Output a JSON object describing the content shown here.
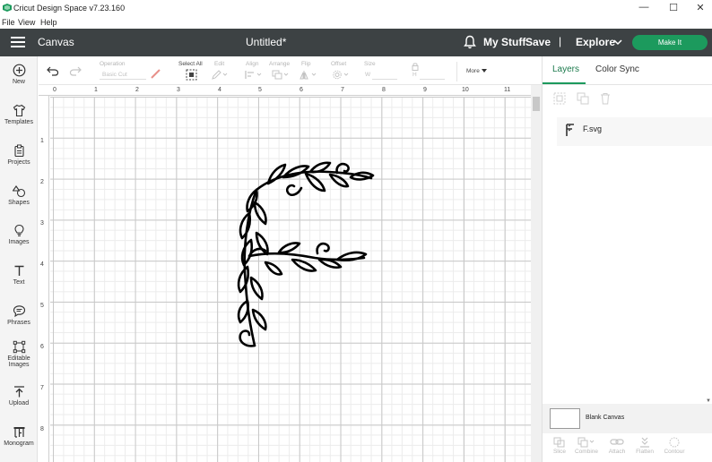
{
  "window": {
    "title": "Cricut Design Space  v7.23.160",
    "controls": [
      "—",
      "☐",
      "✕"
    ]
  },
  "menu": [
    "File",
    "View",
    "Help"
  ],
  "header": {
    "section": "Canvas",
    "document_title": "Untitled*",
    "my_stuff": "My Stuff",
    "save": "Save",
    "separator": "|",
    "explore": "Explore",
    "make_it": "Make It"
  },
  "sidebar": {
    "items": [
      {
        "label": "New",
        "icon": "plus-circle-icon"
      },
      {
        "label": "Templates",
        "icon": "tshirt-icon"
      },
      {
        "label": "Projects",
        "icon": "clipboard-icon"
      },
      {
        "label": "Shapes",
        "icon": "shapes-icon"
      },
      {
        "label": "Images",
        "icon": "lightbulb-icon"
      },
      {
        "label": "Text",
        "icon": "text-t-icon"
      },
      {
        "label": "Phrases",
        "icon": "speech-bubble-icon"
      },
      {
        "label": "Editable",
        "label2": "Images",
        "icon": "editable-images-icon"
      },
      {
        "label": "Upload",
        "icon": "upload-arrow-icon"
      },
      {
        "label": "Monogram",
        "icon": "monogram-icon"
      }
    ]
  },
  "toolbar": {
    "operation_label": "Operation",
    "operation_value": "Basic Cut",
    "select_all": "Select All",
    "edit": "Edit",
    "align": "Align",
    "arrange": "Arrange",
    "flip": "Flip",
    "offset": "Offset",
    "size": "Size",
    "size_w": "W",
    "size_h": "H",
    "more": "More"
  },
  "ruler": {
    "top": [
      "0",
      "1",
      "2",
      "3",
      "4",
      "5",
      "6",
      "7",
      "8",
      "9",
      "10",
      "11"
    ],
    "left": [
      "1",
      "2",
      "3",
      "4",
      "5",
      "6",
      "7",
      "8"
    ]
  },
  "layers_panel": {
    "tab_layers": "Layers",
    "tab_color_sync": "Color Sync",
    "layer_name": "F.svg",
    "blank_canvas": "Blank Canvas",
    "actions": [
      "Slice",
      "Combine",
      "Attach",
      "Flatten",
      "Contour"
    ]
  },
  "colors": {
    "header_bg": "#3d4244",
    "accent_green": "#1c9a5d",
    "canvas_grid": "#c8c8c8"
  }
}
